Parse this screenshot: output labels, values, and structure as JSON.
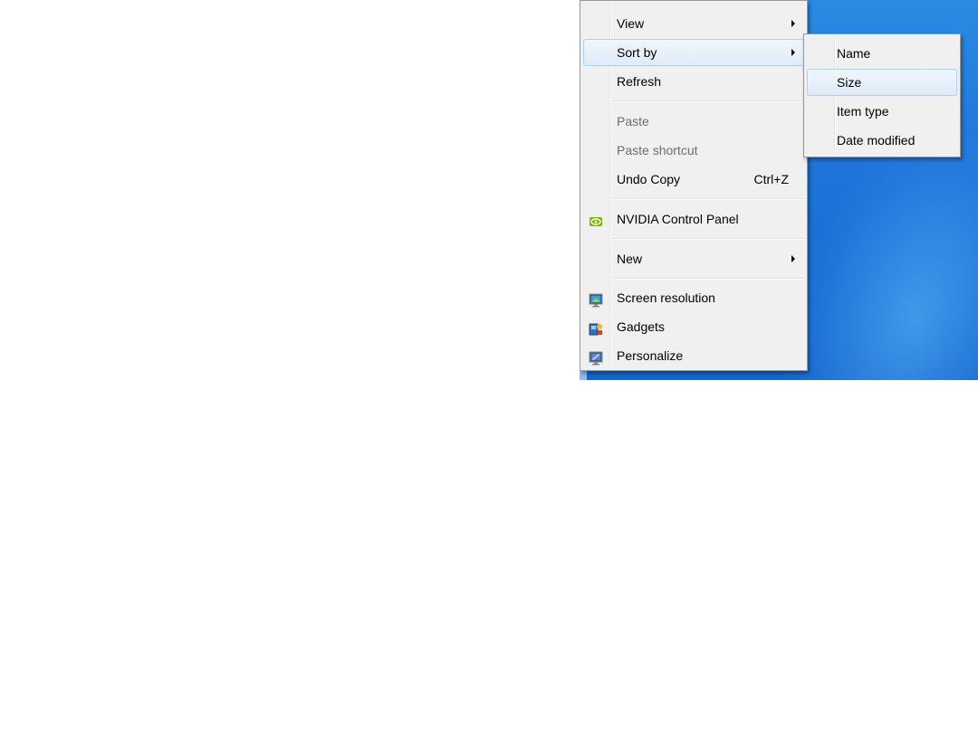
{
  "context_menu": {
    "items": [
      {
        "label": "View",
        "submenu": true
      },
      {
        "label": "Sort by",
        "submenu": true,
        "highlighted": true
      },
      {
        "label": "Refresh"
      },
      {
        "label": "Paste",
        "disabled": true
      },
      {
        "label": "Paste shortcut",
        "disabled": true
      },
      {
        "label": "Undo Copy",
        "shortcut": "Ctrl+Z"
      },
      {
        "label": "NVIDIA Control Panel",
        "icon": "nvidia-icon"
      },
      {
        "label": "New",
        "submenu": true
      },
      {
        "label": "Screen resolution",
        "icon": "screen-resolution-icon"
      },
      {
        "label": "Gadgets",
        "icon": "gadgets-icon"
      },
      {
        "label": "Personalize",
        "icon": "personalize-icon"
      }
    ]
  },
  "sort_submenu": {
    "items": [
      {
        "label": "Name"
      },
      {
        "label": "Size",
        "highlighted": true
      },
      {
        "label": "Item type"
      },
      {
        "label": "Date modified"
      }
    ]
  },
  "colors": {
    "desktop": "#1f74d9",
    "menu_background": "#f0f0f0",
    "highlight_border": "#aecff7"
  }
}
